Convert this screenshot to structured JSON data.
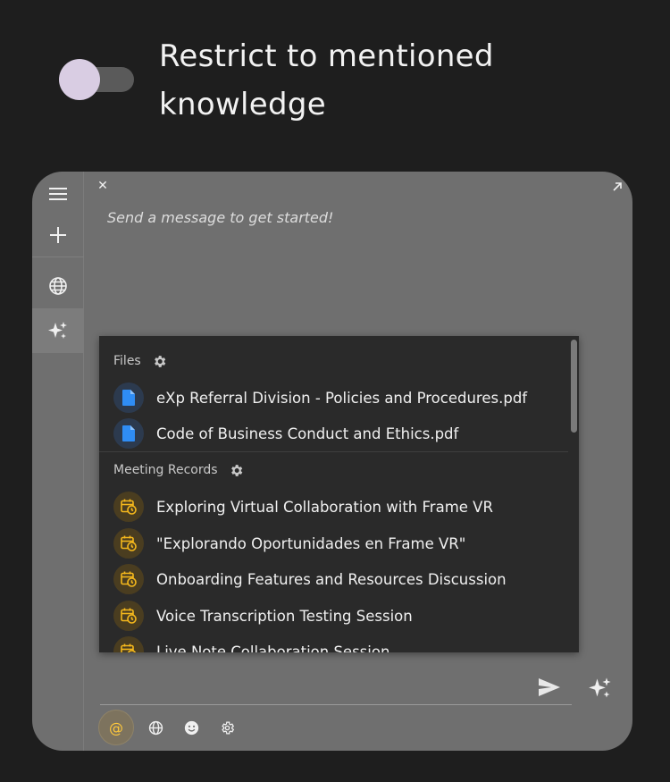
{
  "header": {
    "title": "Restrict to mentioned knowledge",
    "toggle_on": false
  },
  "chat": {
    "placeholder": "Send a message to get started!"
  },
  "dropdown": {
    "files_section": {
      "label": "Files",
      "items": [
        "eXp Referral Division - Policies and Procedures.pdf",
        "Code of Business Conduct and Ethics.pdf"
      ]
    },
    "meetings_section": {
      "label": "Meeting Records",
      "items": [
        "Exploring Virtual Collaboration with Frame VR",
        "\"Explorando Oportunidades en Frame VR\"",
        "Onboarding Features and Resources Discussion",
        "Voice Transcription Testing Session",
        "Live Note Collaboration Session"
      ]
    }
  },
  "toolbar": {
    "mention_symbol": "@"
  },
  "icons": {
    "menu": "hamburger-icon",
    "new": "plus-icon",
    "web": "globe-icon",
    "ai": "sparkle-icon",
    "close": "close-icon",
    "expand": "expand-arrow-icon",
    "file": "document-icon",
    "meeting": "calendar-clock-icon",
    "settings": "gear-icon",
    "send": "send-icon",
    "emoji": "smiley-icon"
  },
  "colors": {
    "file_accent": "#2f8df5",
    "meeting_accent": "#f5b81c",
    "toggle_knob": "#d9cde3",
    "panel_bg": "#6f6f6f",
    "dropdown_bg": "#2a2a2a"
  }
}
